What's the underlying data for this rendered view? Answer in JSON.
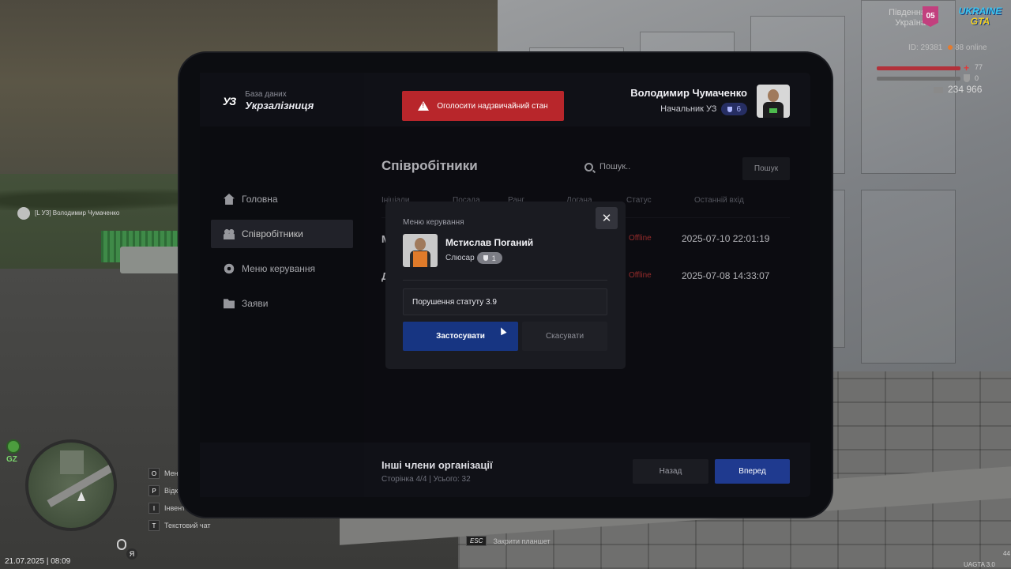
{
  "hud": {
    "region_line1": "Південна",
    "region_line2": "Україна",
    "server_badge": "05",
    "logo_top": "UKRAINE",
    "logo_bottom": "GTA",
    "player_id": "ID: 29381",
    "online": "88 online",
    "health_value": "77",
    "armor_value": "0",
    "money": "234 966",
    "nametag": "[L УЗ] Володимир Чумаченко",
    "gz_label": "GZ",
    "mic_key": "Я",
    "datetime": "21.07.2025 | 08:09",
    "hotkeys": [
      {
        "key": "O",
        "label": "Меню"
      },
      {
        "key": "P",
        "label": "Відк"
      },
      {
        "key": "I",
        "label": "Інвент"
      },
      {
        "key": "T",
        "label": "Текстовий чат"
      }
    ],
    "esc_key": "ESC",
    "esc_label": "Закрити планшет",
    "version": "UAGTA 3.0",
    "fps": "44"
  },
  "brand": {
    "logo": "УЗ",
    "subtitle": "База даних",
    "title": "Укрзалізниця"
  },
  "sidebar": {
    "items": [
      {
        "label": "Головна",
        "icon": "home-icon",
        "active": false
      },
      {
        "label": "Співробітники",
        "icon": "people-icon",
        "active": true
      },
      {
        "label": "Меню керування",
        "icon": "gear-icon",
        "active": false
      },
      {
        "label": "Заяви",
        "icon": "folder-icon",
        "active": false
      }
    ]
  },
  "header": {
    "alarm_label": "Оголосити надзвичайний стан",
    "user_name": "Володимир Чумаченко",
    "user_role": "Начальник УЗ",
    "user_rank": "6"
  },
  "main": {
    "title": "Співробітники",
    "search_placeholder": "Пошук..",
    "search_button": "Пошук",
    "columns": [
      "Ініціали",
      "Посада",
      "Ранг",
      "Догана",
      "Статус",
      "Останній вхід"
    ],
    "rows": [
      {
        "initial": "М",
        "status": "Offline",
        "last_login": "2025-07-10 22:01:19"
      },
      {
        "initial": "Д",
        "status": "Offline",
        "last_login": "2025-07-08 14:33:07"
      }
    ],
    "footer_title": "Інші члени організації",
    "footer_sub": "Сторінка 4/4 | Усього: 32",
    "back_label": "Назад",
    "forward_label": "Вперед"
  },
  "modal": {
    "label": "Меню керування",
    "close": "✕",
    "employee_name": "Мстислав Поганий",
    "employee_role": "Слюсар",
    "employee_rank": "1",
    "reason_value": "Порушення статуту 3.9",
    "apply_label": "Застосувати",
    "cancel_label": "Скасувати"
  },
  "colors": {
    "accent_blue": "#173582",
    "alarm_red": "#b8262b",
    "offline_red": "#c93a3a"
  }
}
